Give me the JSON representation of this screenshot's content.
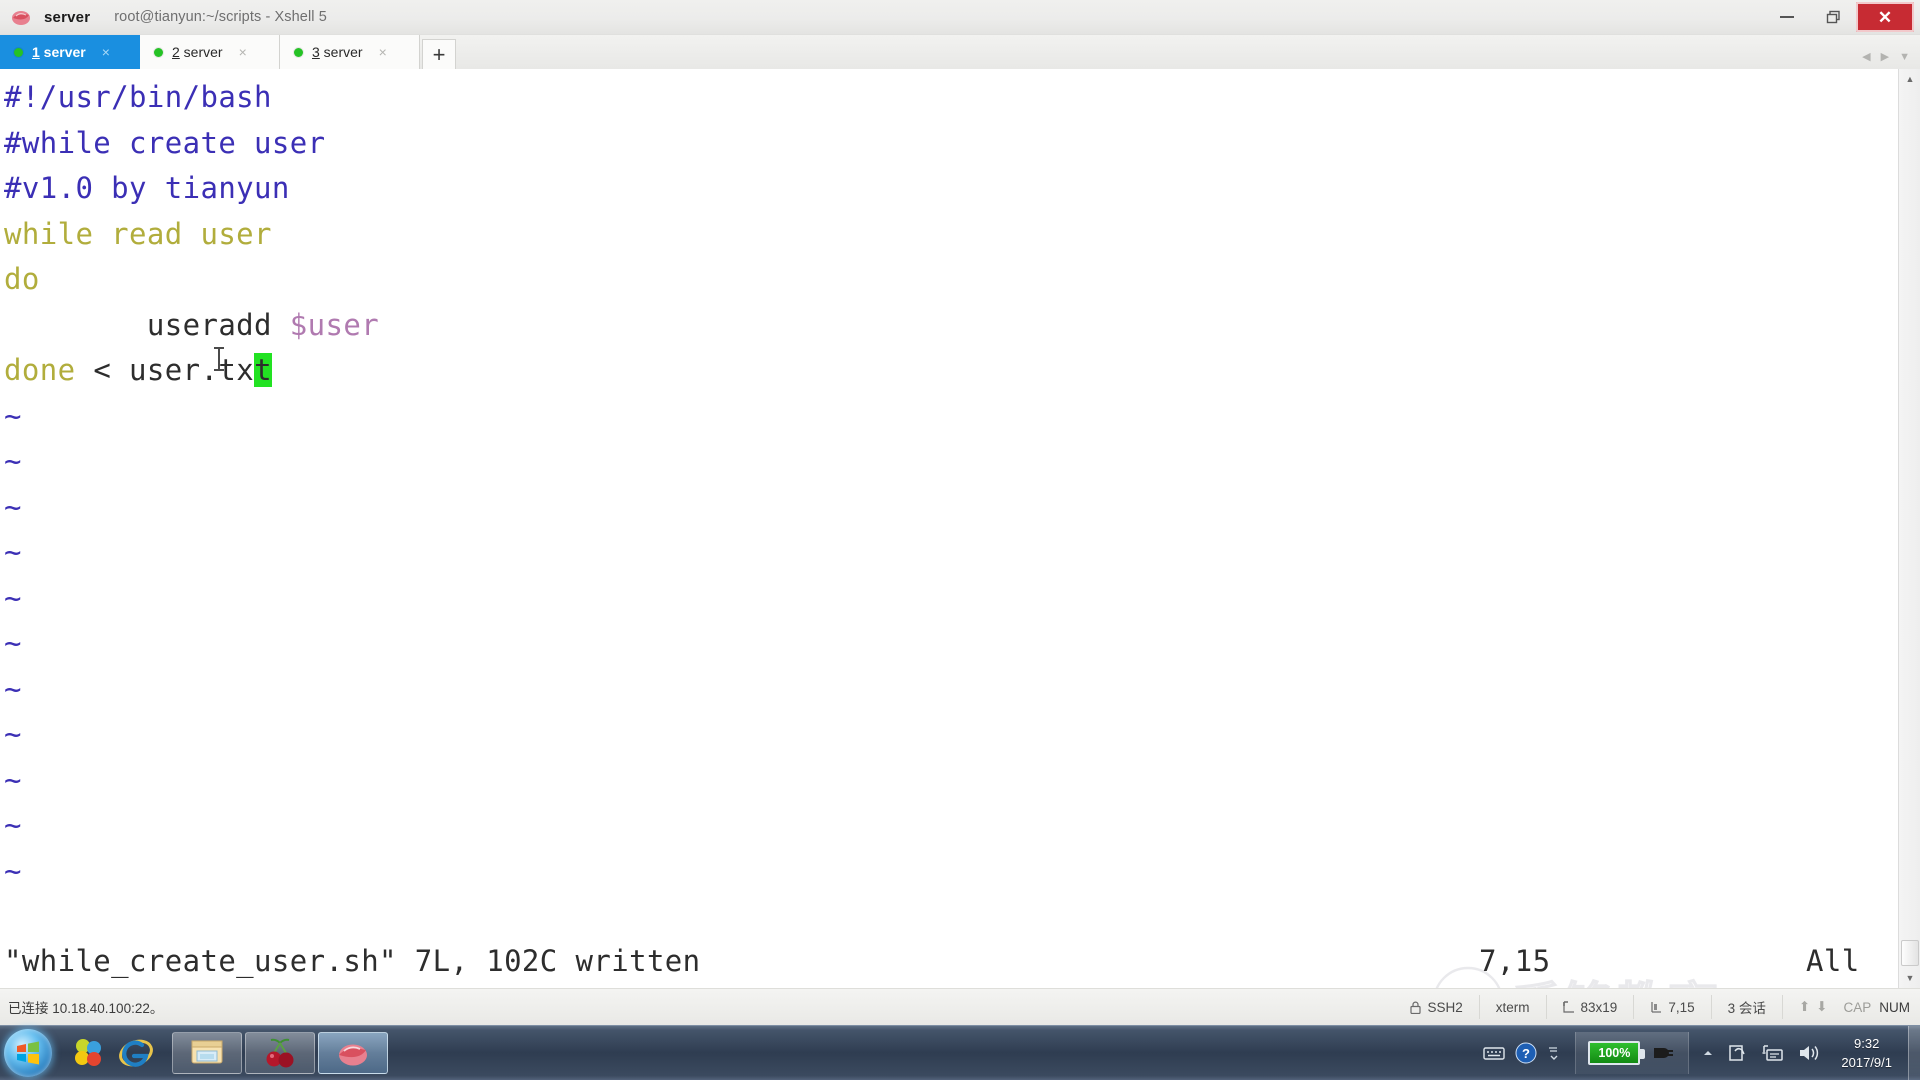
{
  "window": {
    "app_icon": "xshell-icon",
    "app_name": "server",
    "title_path": "root@tianyun:~/scripts - Xshell 5",
    "minimize_label": "–",
    "restore_label": "❐",
    "close_label": "✕"
  },
  "tabs": {
    "items": [
      {
        "accel": "1",
        "label": " server",
        "active": true,
        "status_dot": "#25c225",
        "close_label": "×"
      },
      {
        "accel": "2",
        "label": " server",
        "active": false,
        "status_dot": "#25c225",
        "close_label": "×"
      },
      {
        "accel": "3",
        "label": " server",
        "active": false,
        "status_dot": "#25c225",
        "close_label": "×"
      }
    ],
    "add_label": "+",
    "nav_prev": "◀",
    "nav_next": "▶",
    "nav_list": "▼"
  },
  "terminal": {
    "lines": [
      [
        {
          "t": "#!/usr/bin/bash",
          "c": "c-comment"
        }
      ],
      [
        {
          "t": "#while create user",
          "c": "c-comment"
        }
      ],
      [
        {
          "t": "#v1.0 by tianyun",
          "c": "c-comment"
        }
      ],
      [
        {
          "t": "while read user",
          "c": "c-keyword"
        }
      ],
      [
        {
          "t": "do",
          "c": "c-keyword"
        }
      ],
      [
        {
          "t": "        useradd ",
          "c": "c-plain"
        },
        {
          "t": "$user",
          "c": "c-var"
        }
      ],
      [
        {
          "t": "done ",
          "c": "c-keyword"
        },
        {
          "t": "< user.tx",
          "c": "c-plain"
        },
        {
          "t": "t",
          "c": "cursor-blk"
        }
      ],
      [
        {
          "t": "~",
          "c": "c-tilde"
        }
      ],
      [
        {
          "t": "~",
          "c": "c-tilde"
        }
      ],
      [
        {
          "t": "~",
          "c": "c-tilde"
        }
      ],
      [
        {
          "t": "~",
          "c": "c-tilde"
        }
      ],
      [
        {
          "t": "~",
          "c": "c-tilde"
        }
      ],
      [
        {
          "t": "~",
          "c": "c-tilde"
        }
      ],
      [
        {
          "t": "~",
          "c": "c-tilde"
        }
      ],
      [
        {
          "t": "~",
          "c": "c-tilde"
        }
      ],
      [
        {
          "t": "~",
          "c": "c-tilde"
        }
      ],
      [
        {
          "t": "~",
          "c": "c-tilde"
        }
      ],
      [
        {
          "t": "~",
          "c": "c-tilde"
        }
      ]
    ],
    "status_file": "\"while_create_user.sh\" 7L, 102C written",
    "status_position": "7,15",
    "status_scroll": "All",
    "watermark_text": "千锋教育"
  },
  "statusbar": {
    "connection": "已连接 10.18.40.100:22。",
    "protocol": "SSH2",
    "term_type": "xterm",
    "size": "83x19",
    "cursor_pos": "7,15",
    "sessions": "3 会话",
    "caps": "CAP",
    "num": "NUM"
  },
  "taskbar": {
    "start_label": "start-orb",
    "quick_launch": [
      "skype-icon",
      "internet-explorer-icon"
    ],
    "tasks": [
      "explorer-icon",
      "cherry-icon",
      "xshell-icon"
    ],
    "tray": {
      "keyboard_icon": "keyboard-icon",
      "help_icon": "?",
      "expand_icon": "▲",
      "battery_percent": "100%",
      "power_icon": "power-plug-icon",
      "network_icon": "network-icon",
      "volume_icon": "volume-icon",
      "time": "9:32",
      "date": "2017/9/1"
    }
  }
}
